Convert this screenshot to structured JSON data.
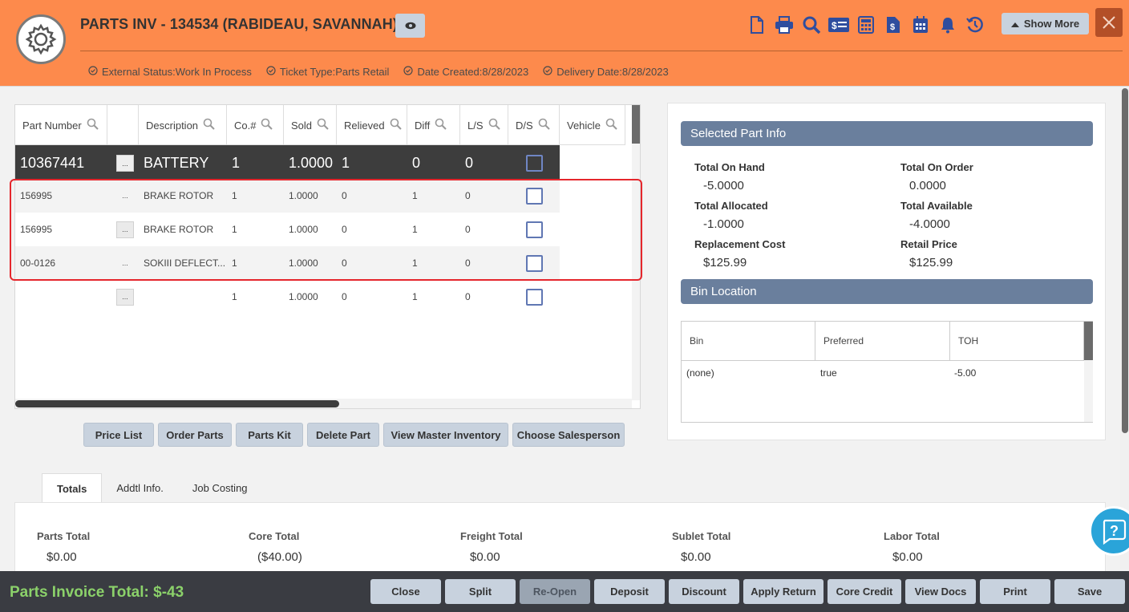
{
  "header": {
    "title": "PARTS INV - 134534 (RABIDEAU, SAVANNAH)",
    "show_more": "Show More",
    "status": [
      {
        "label": "External Status:Work In Process"
      },
      {
        "label": "Ticket Type:Parts Retail"
      },
      {
        "label": "Date Created:8/28/2023"
      },
      {
        "label": "Delivery Date:8/28/2023"
      }
    ]
  },
  "grid": {
    "columns": [
      "Part Number",
      "",
      "Description",
      "Co.#",
      "Sold",
      "Relieved",
      "Diff",
      "L/S",
      "D/S",
      "Vehicle"
    ],
    "rows": [
      {
        "part": "10367441",
        "desc": "BATTERY",
        "co": "1",
        "sold": "1.0000",
        "relieved": "1",
        "diff": "0",
        "ls": "0"
      },
      {
        "part": "156995",
        "desc": "BRAKE ROTOR",
        "co": "1",
        "sold": "1.0000",
        "relieved": "0",
        "diff": "1",
        "ls": "0"
      },
      {
        "part": "156995",
        "desc": "BRAKE ROTOR",
        "co": "1",
        "sold": "1.0000",
        "relieved": "0",
        "diff": "1",
        "ls": "0"
      },
      {
        "part": "00-0126",
        "desc": "SOKIII DEFLECT...",
        "co": "1",
        "sold": "1.0000",
        "relieved": "0",
        "diff": "1",
        "ls": "0"
      },
      {
        "part": "",
        "desc": "",
        "co": "1",
        "sold": "1.0000",
        "relieved": "0",
        "diff": "1",
        "ls": "0"
      }
    ]
  },
  "grid_buttons": [
    "Price List",
    "Order Parts",
    "Parts Kit",
    "Delete Part",
    "View Master Inventory",
    "Choose Salesperson"
  ],
  "part_info": {
    "title": "Selected Part Info",
    "total_on_hand_label": "Total On Hand",
    "total_on_hand": "-5.0000",
    "total_on_order_label": "Total On Order",
    "total_on_order": "0.0000",
    "total_allocated_label": "Total Allocated",
    "total_allocated": "-1.0000",
    "total_available_label": "Total Available",
    "total_available": "-4.0000",
    "replacement_cost_label": "Replacement Cost",
    "replacement_cost": "$125.99",
    "retail_price_label": "Retail Price",
    "retail_price": "$125.99"
  },
  "bin": {
    "title": "Bin Location",
    "columns": [
      "Bin",
      "Preferred",
      "TOH"
    ],
    "row": {
      "bin": "(none)",
      "preferred": "true",
      "toh": "-5.00"
    }
  },
  "tabs": [
    "Totals",
    "Addtl Info.",
    "Job Costing"
  ],
  "totals": [
    {
      "label": "Parts Total",
      "value": "$0.00"
    },
    {
      "label": "Core Total",
      "value": "($40.00)"
    },
    {
      "label": "Freight Total",
      "value": "$0.00"
    },
    {
      "label": "Sublet Total",
      "value": "$0.00"
    },
    {
      "label": "Labor Total",
      "value": "$0.00"
    }
  ],
  "footer": {
    "total": "Parts Invoice Total: $-43",
    "buttons": [
      "Close",
      "Split",
      "Re-Open",
      "Deposit",
      "Discount",
      "Apply Return",
      "Core Credit",
      "View Docs",
      "Print",
      "Save"
    ]
  },
  "colors": {
    "header": "#fd8a4c",
    "footer": "#3a3c42",
    "accent": "#6a7f9d",
    "total_green": "#8bd16a"
  }
}
